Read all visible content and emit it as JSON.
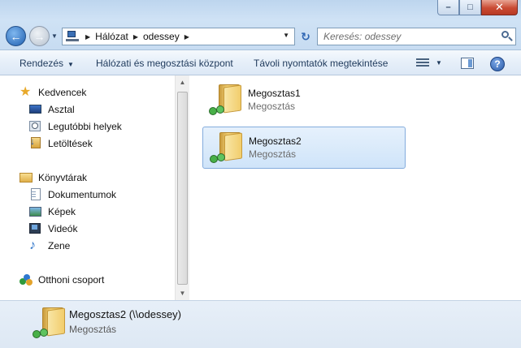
{
  "window": {
    "buttons": {
      "minimize": "–",
      "maximize": "□",
      "close": "✕"
    }
  },
  "navigation": {
    "back_icon": "←",
    "forward_icon": "→",
    "breadcrumb": [
      "Hálózat",
      "odessey"
    ],
    "separator": "▶",
    "dropdown_glyph": "▼",
    "refresh_glyph": "↻"
  },
  "search": {
    "placeholder": "Keresés: odessey"
  },
  "toolbar": {
    "organize": "Rendezés",
    "network_center": "Hálózati és megosztási központ",
    "remote_printers": "Távoli nyomtatók megtekintése",
    "help": "?"
  },
  "sidebar": {
    "favorites": {
      "label": "Kedvencek",
      "items": [
        "Asztal",
        "Legutóbbi helyek",
        "Letöltések"
      ]
    },
    "libraries": {
      "label": "Könyvtárak",
      "items": [
        "Dokumentumok",
        "Képek",
        "Videók",
        "Zene"
      ]
    },
    "homegroup": {
      "label": "Otthoni csoport"
    }
  },
  "content": {
    "items": [
      {
        "name": "Megosztas1",
        "type": "Megosztás",
        "selected": false
      },
      {
        "name": "Megosztas2",
        "type": "Megosztás",
        "selected": true
      }
    ]
  },
  "details": {
    "name": "Megosztas2 (\\\\odessey)",
    "type": "Megosztás"
  },
  "colors": {
    "selection_fill": "#cfe4f9",
    "selection_border": "#84acdd",
    "toolbar_text": "#1e395b"
  }
}
